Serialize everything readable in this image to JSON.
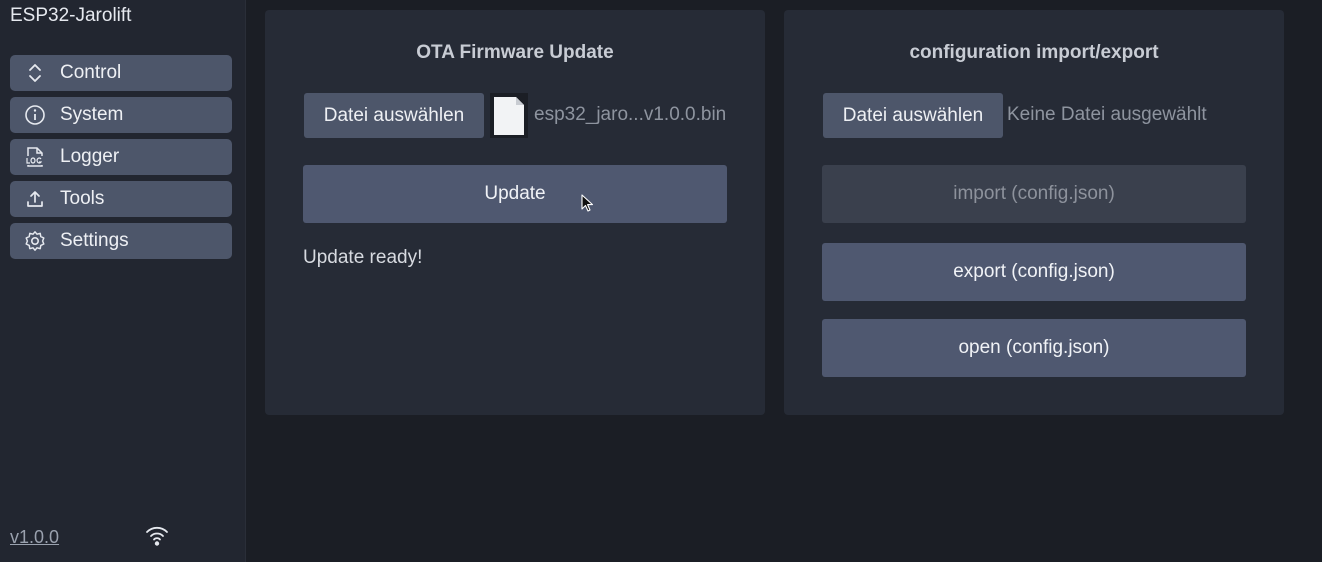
{
  "app": {
    "title": "ESP32-Jarolift",
    "version": "v1.0.0"
  },
  "sidebar": {
    "items": [
      {
        "label": "Control",
        "icon": "chevron-up-down-icon"
      },
      {
        "label": "System",
        "icon": "info-icon"
      },
      {
        "label": "Logger",
        "icon": "log-file-icon"
      },
      {
        "label": "Tools",
        "icon": "upload-icon"
      },
      {
        "label": "Settings",
        "icon": "gear-icon"
      }
    ],
    "wifi_icon": "wifi-icon"
  },
  "ota": {
    "title": "OTA Firmware Update",
    "choose_file_label": "Datei auswählen",
    "file_name": "esp32_jaro...v1.0.0.bin",
    "update_label": "Update",
    "status": "Update ready!"
  },
  "config": {
    "title": "configuration import/export",
    "choose_file_label": "Datei auswählen",
    "file_name": "Keine Datei ausgewählt",
    "import_label": "import (config.json)",
    "export_label": "export (config.json)",
    "open_label": "open (config.json)"
  },
  "colors": {
    "background": "#1b1e25",
    "sidebar": "#222630",
    "panel": "#262b36",
    "button": "#4f5870",
    "button_disabled": "#3a404d"
  }
}
